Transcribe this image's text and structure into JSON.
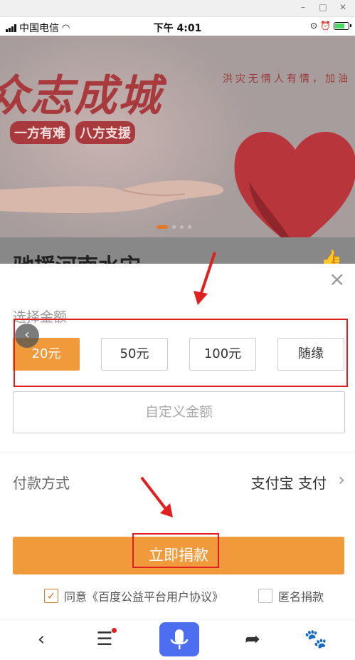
{
  "status_bar": {
    "carrier": "中国电信",
    "time": "下午 4:01"
  },
  "banner": {
    "title": "众志成城",
    "tags": [
      "一方有难",
      "八方支援"
    ],
    "slogan": "洪灾无情人有情，加油"
  },
  "project": {
    "title": "驰援河南水灾"
  },
  "donation": {
    "select_label": "选择金额",
    "amounts": [
      {
        "label": "20元",
        "selected": true
      },
      {
        "label": "50元",
        "selected": false
      },
      {
        "label": "100元",
        "selected": false
      },
      {
        "label": "随缘",
        "selected": false
      }
    ],
    "custom_placeholder": "自定义金额",
    "payment_label": "付款方式",
    "payment_value": "支付宝 支付",
    "donate_button": "立即捐款",
    "agree_label": "同意《百度公益平台用户协议》",
    "agree_checked": true,
    "anonymous_label": "匿名捐款",
    "anonymous_checked": false
  },
  "colors": {
    "accent": "#f09a3c",
    "banner_red": "#a83a3d",
    "highlight": "#e02020",
    "mic_blue": "#4e6ef2"
  }
}
